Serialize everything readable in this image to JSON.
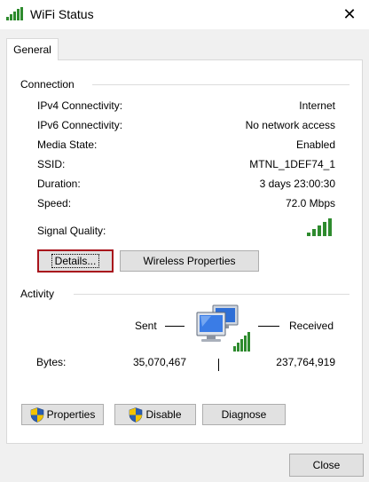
{
  "window": {
    "title": "WiFi Status",
    "close_glyph": "✕",
    "icon": "wifi-signal-icon"
  },
  "tabs": [
    {
      "label": "General",
      "selected": true
    }
  ],
  "connection": {
    "title": "Connection",
    "rows": [
      {
        "label": "IPv4 Connectivity:",
        "value": "Internet"
      },
      {
        "label": "IPv6 Connectivity:",
        "value": "No network access"
      },
      {
        "label": "Media State:",
        "value": "Enabled"
      },
      {
        "label": "SSID:",
        "value": "MTNL_1DEF74_1"
      },
      {
        "label": "Duration:",
        "value": "3 days 23:00:30"
      },
      {
        "label": "Speed:",
        "value": "72.0 Mbps"
      }
    ],
    "signal_quality_label": "Signal Quality:",
    "signal_bars": 5,
    "signal_bars_total": 5,
    "details_button": "Details...",
    "wireless_properties_button": "Wireless Properties"
  },
  "activity": {
    "title": "Activity",
    "sent_label": "Sent",
    "received_label": "Received",
    "bytes_label": "Bytes:",
    "bytes_sent": "35,070,467",
    "bytes_received": "237,764,919",
    "icon": "network-computers-icon"
  },
  "actions": {
    "properties": "Properties",
    "disable": "Disable",
    "diagnose": "Diagnose"
  },
  "footer": {
    "close": "Close"
  },
  "colors": {
    "signal_green": "#2e8b2e",
    "focus_border": "#a8141c",
    "button_face": "#e1e1e1",
    "shield_blue": "#2a5db0",
    "shield_yellow": "#f3c300"
  }
}
